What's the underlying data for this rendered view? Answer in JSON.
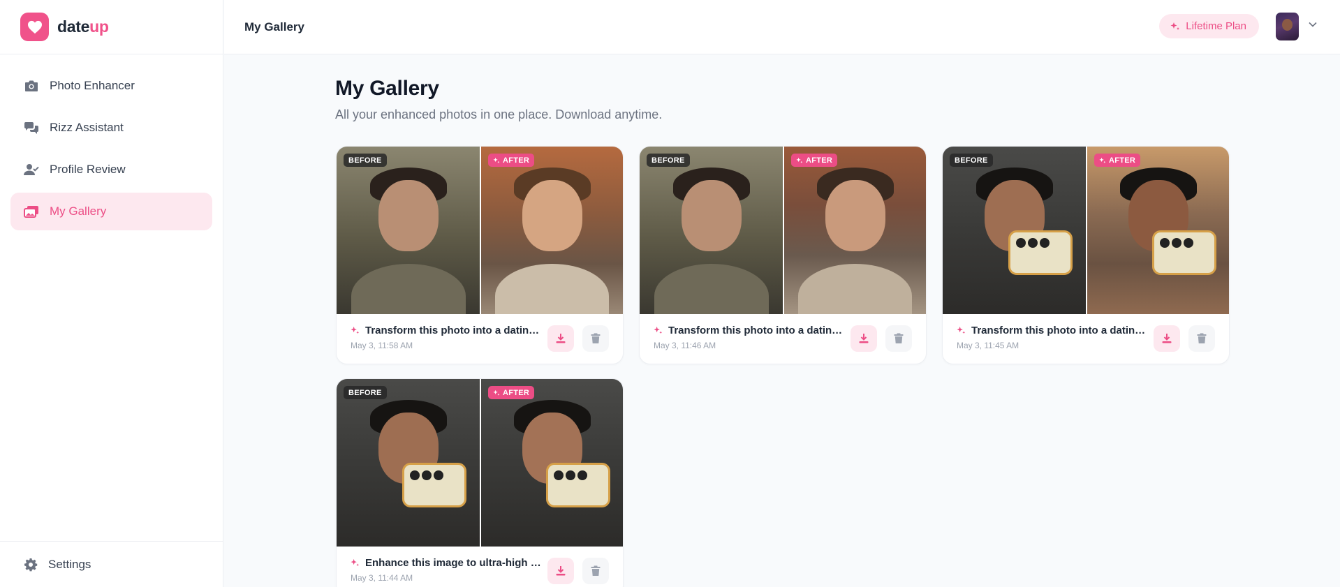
{
  "app": {
    "logo_text_main": "date",
    "logo_text_accent": "up",
    "brand_color": "#f0528a"
  },
  "sidebar": {
    "items": [
      {
        "label": "Photo Enhancer",
        "icon": "camera-icon",
        "active": false
      },
      {
        "label": "Rizz Assistant",
        "icon": "chat-bubbles-icon",
        "active": false
      },
      {
        "label": "Profile Review",
        "icon": "user-check-icon",
        "active": false
      },
      {
        "label": "My Gallery",
        "icon": "gallery-icon",
        "active": true
      }
    ],
    "settings_label": "Settings"
  },
  "header": {
    "title": "My Gallery",
    "plan_label": "Lifetime Plan",
    "plan_icon": "sparkle-icon",
    "avatar_icon": "avatar",
    "menu_icon": "chevron-down-icon"
  },
  "main": {
    "title": "My Gallery",
    "subtitle": "All your enhanced photos in one place. Download anytime.",
    "before_label": "BEFORE",
    "after_label": "AFTER",
    "cards": [
      {
        "title": "Transform this photo into a dating pr...",
        "date": "May 3, 11:58 AM"
      },
      {
        "title": "Transform this photo into a dating pr...",
        "date": "May 3, 11:46 AM"
      },
      {
        "title": "Transform this photo into a dating pr...",
        "date": "May 3, 11:45 AM"
      },
      {
        "title": "Enhance this image to ultra-high defi...",
        "date": "May 3, 11:44 AM"
      }
    ]
  }
}
